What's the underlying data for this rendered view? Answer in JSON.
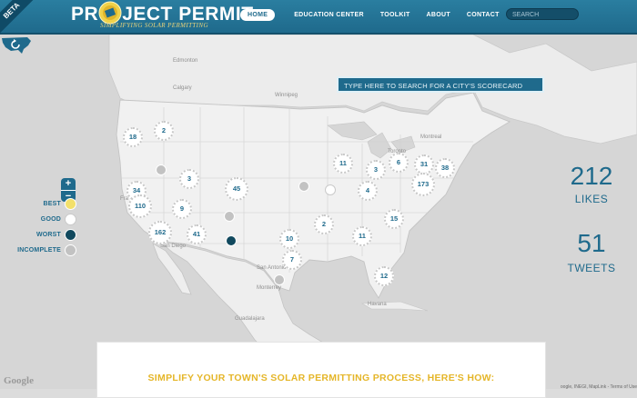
{
  "header": {
    "beta": "BETA",
    "logo_left": "PR",
    "logo_right": "JECT PERMIT",
    "tagline": "SIMPLIFYING SOLAR PERMITTING",
    "nav": [
      {
        "label": "HOME",
        "active": true
      },
      {
        "label": "EDUCATION CENTER",
        "active": false
      },
      {
        "label": "TOOLKIT",
        "active": false
      },
      {
        "label": "ABOUT",
        "active": false
      },
      {
        "label": "CONTACT",
        "active": false
      }
    ],
    "search_placeholder": "SEARCH"
  },
  "map": {
    "city_search_placeholder": "TYPE HERE TO SEARCH FOR A CITY'S SCORECARD",
    "labels": [
      "Edmonton",
      "Calgary",
      "Winnipeg",
      "Montreal",
      "Toronto",
      "San Antonio",
      "Monterrey",
      "Havana",
      "Guadalajara",
      "San Diego",
      "Fra"
    ],
    "clusters": [
      "18",
      "2",
      "3",
      "45",
      "34",
      "110",
      "9",
      "162",
      "41",
      "10",
      "7",
      "2",
      "11",
      "11",
      "3",
      "6",
      "31",
      "38",
      "173",
      "4",
      "15",
      "12"
    ],
    "pin_types": [
      "incomplete",
      "incomplete",
      "good",
      "incomplete",
      "worst",
      "incomplete"
    ]
  },
  "legend": [
    {
      "label": "BEST",
      "color": "#f3e06b"
    },
    {
      "label": "GOOD",
      "color": "#ffffff"
    },
    {
      "label": "WORST",
      "color": "#11495e"
    },
    {
      "label": "INCOMPLETE",
      "color": "#c2c2c2"
    }
  ],
  "stats": {
    "likes_count": "212",
    "likes_label": "LIKES",
    "tweets_count": "51",
    "tweets_label": "TWEETS"
  },
  "panel": {
    "title": "SIMPLIFY YOUR TOWN'S SOLAR PERMITTING PROCESS, HERE'S HOW:"
  },
  "footer": {
    "google": "Google",
    "attribution": "oogle, INEGI, MapLink - Terms of Use"
  },
  "colors": {
    "brand": "#1f6a8c",
    "accent": "#e5b629"
  }
}
